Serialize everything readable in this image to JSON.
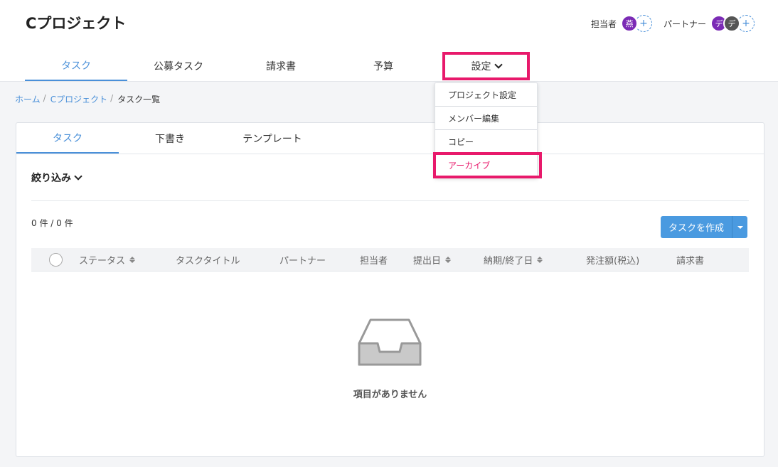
{
  "project": {
    "title": "Cプロジェクト"
  },
  "people": {
    "assignee_label": "担当者",
    "assignee_avatar": "燕",
    "partner_label": "パートナー",
    "partner_avatars": [
      "デ",
      "デ"
    ],
    "add_symbol": "+"
  },
  "main_tabs": [
    {
      "label": "タスク",
      "active": true
    },
    {
      "label": "公募タスク"
    },
    {
      "label": "請求書"
    },
    {
      "label": "予算"
    }
  ],
  "settings_tab": {
    "label": "設定"
  },
  "settings_menu": [
    {
      "label": "プロジェクト設定"
    },
    {
      "label": "メンバー編集"
    },
    {
      "label": "コピー"
    },
    {
      "label": "アーカイブ"
    }
  ],
  "breadcrumb": {
    "home": "ホーム",
    "project": "Cプロジェクト",
    "current": "タスク一覧",
    "separator": "/"
  },
  "sub_tabs": [
    {
      "label": "タスク",
      "active": true
    },
    {
      "label": "下書き"
    },
    {
      "label": "テンプレート"
    }
  ],
  "filter": {
    "label": "絞り込み"
  },
  "count_text": "0 件 / 0 件",
  "create_button": {
    "label": "タスクを作成"
  },
  "table": {
    "columns": {
      "status": "ステータス",
      "title": "タスクタイトル",
      "partner": "パートナー",
      "assignee": "担当者",
      "submitted": "提出日",
      "deadline": "納期/終了日",
      "amount": "発注額(税込)",
      "invoice": "請求書"
    }
  },
  "empty": {
    "message": "項目がありません"
  },
  "colors": {
    "accent": "#4a90d9",
    "highlight": "#e8196b",
    "avatar": "#7b2bb5"
  }
}
